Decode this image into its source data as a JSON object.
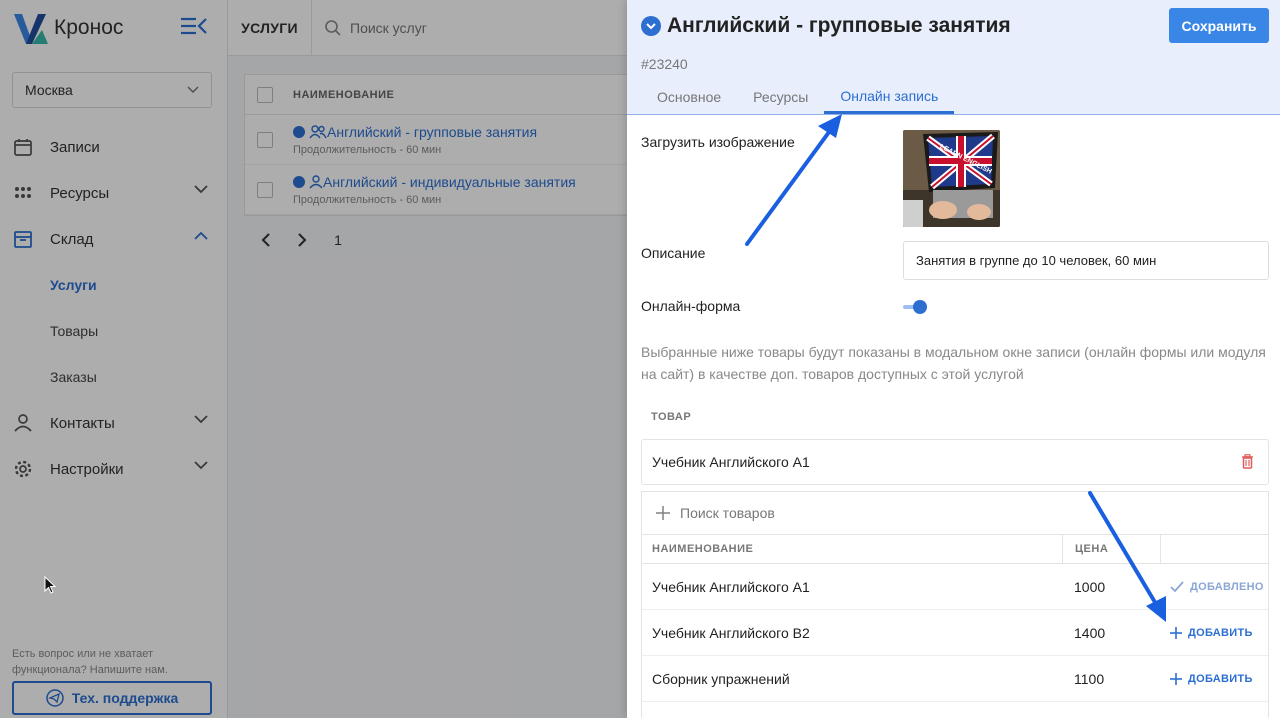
{
  "app": {
    "name": "Кронос"
  },
  "sidebar": {
    "city": "Москва",
    "items": [
      {
        "label": "Записи",
        "icon": "calendar-icon"
      },
      {
        "label": "Ресурсы",
        "icon": "resources-icon"
      },
      {
        "label": "Склад",
        "icon": "archive-icon"
      },
      {
        "label": "Контакты",
        "icon": "user-icon"
      },
      {
        "label": "Настройки",
        "icon": "gear-icon"
      }
    ],
    "sub_items": [
      "Услуги",
      "Товары",
      "Заказы"
    ],
    "help_text": "Есть вопрос или не хватает функционала? Напишите нам.",
    "support_label": "Тех. поддержка"
  },
  "main": {
    "page_label": "УСЛУГИ",
    "search_placeholder": "Поиск услуг",
    "column_name": "НАИМЕНОВАНИЕ",
    "rows": [
      {
        "title": "Английский - групповые занятия",
        "sub": "Продолжительность - 60 мин"
      },
      {
        "title": "Английский - индивидуальные занятия",
        "sub": "Продолжительность - 60 мин"
      }
    ],
    "page": "1"
  },
  "panel": {
    "title": "Английский - групповые занятия",
    "record_id": "#23240",
    "save_label": "Сохранить",
    "tabs": [
      "Основное",
      "Ресурсы",
      "Онлайн запись"
    ],
    "active_tab": 2,
    "upload_label": "Загрузить изображение",
    "image_caption": "LEARN ENGLISH",
    "description_label": "Описание",
    "description_value": "Занятия в группе до 10 человек, 60 мин",
    "online_form_label": "Онлайн-форма",
    "online_form_on": true,
    "hint": "Выбранные ниже товары будут показаны в модальном окне записи (онлайн формы или модуля на сайт) в качестве доп. товаров доступных с этой услугой",
    "goods_label": "ТОВАР",
    "selected_product": "Учебник Английского А1",
    "product_search_placeholder": "Поиск товаров",
    "table": {
      "col_name": "НАИМЕНОВАНИЕ",
      "col_price": "ЦЕНА",
      "rows": [
        {
          "name": "Учебник Английского А1",
          "price": "1000",
          "action": "ДОБАВЛЕНО"
        },
        {
          "name": "Учебник Английского В2",
          "price": "1400",
          "action": "ДОБАВИТЬ"
        },
        {
          "name": "Сборник упражнений",
          "price": "1100",
          "action": "ДОБАВИТЬ"
        }
      ]
    }
  },
  "colors": {
    "accent": "#2c6fd1",
    "arrow": "#1a5fe0",
    "save": "#3a86e6",
    "delete": "#e25c5c"
  }
}
